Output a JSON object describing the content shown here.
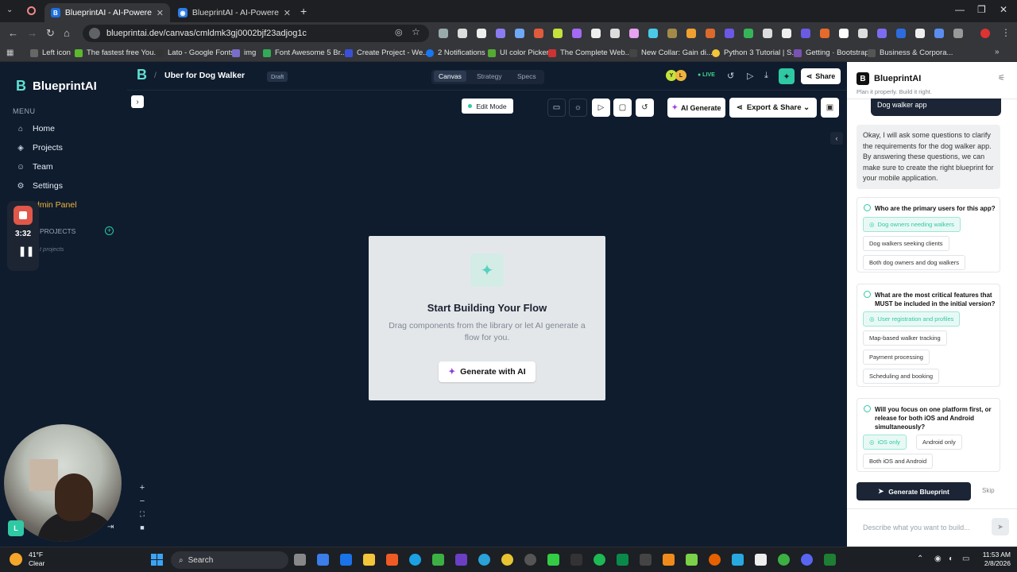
{
  "browser": {
    "tabs": [
      {
        "label": "BlueprintAI - AI-Powered P",
        "active": true
      },
      {
        "label": "BlueprintAI - AI-Powered Proje",
        "active": false
      }
    ],
    "url": "blueprintai.dev/canvas/cmldmk3gj0002bjf23adjog1c",
    "bookmarks": [
      "Left icon",
      "The fastest free You...",
      "Lato - Google Fonts",
      "img",
      "Font Awesome 5 Br...",
      "Create Project - We...",
      "2 Notifications",
      "UI color Picker",
      "The Complete Web...",
      "New Collar: Gain di...",
      "Python 3 Tutorial | S...",
      "Getting · Bootstrap",
      "Business & Corpora..."
    ]
  },
  "sidebar": {
    "brand": "BlueprintAI",
    "menu_label": "MENU",
    "items": [
      {
        "label": "Home",
        "icon": "home-icon"
      },
      {
        "label": "Projects",
        "icon": "layers-icon"
      },
      {
        "label": "Team",
        "icon": "team-icon"
      },
      {
        "label": "Settings",
        "icon": "gear-icon"
      },
      {
        "label": "dmin Panel",
        "icon": "shield-icon"
      }
    ],
    "projects_label": "PROJECTS",
    "projects_empty": "t projects",
    "recorder_time": "3:32",
    "user_initial": "L"
  },
  "canvas_header": {
    "logo": "B",
    "separator": "/",
    "project_title": "Uber for Dog Walker",
    "status_badge": "Draft",
    "view_tabs": [
      "Canvas",
      "Strategy",
      "Specs"
    ],
    "selected_view": "Canvas",
    "avatars": [
      "Y",
      "L"
    ],
    "live_label": "● LIVE",
    "share_label": "Share"
  },
  "toolbar": {
    "edit_mode": "Edit Mode",
    "ai_generate": "AI Generate",
    "export_share": "Export & Share ⌄"
  },
  "empty_state": {
    "title": "Start Building Your Flow",
    "description": "Drag components from the library or let AI generate a flow for you.",
    "button": "Generate with AI"
  },
  "ai_panel": {
    "title": "BlueprintAI",
    "subtitle": "Plan it properly. Build it right.",
    "user_message": "Dog walker app",
    "ai_message": "Okay, I will ask some questions to clarify the requirements for the dog walker app. By answering these questions, we can make sure to create the right blueprint for your mobile application.",
    "questions": [
      {
        "question": "Who are the primary users for this app?",
        "options": [
          "Dog owners needing walkers",
          "Dog walkers seeking clients",
          "Both dog owners and dog walkers"
        ],
        "selected": 0
      },
      {
        "question": "What are the most critical features that MUST be included in the initial version?",
        "options": [
          "User registration and profiles",
          "Map-based walker tracking",
          "Payment processing",
          "Scheduling and booking"
        ],
        "selected": 0
      },
      {
        "question": "Will you focus on one platform first, or release for both iOS and Android simultaneously?",
        "options": [
          "iOS only",
          "Android only",
          "Both iOS and Android"
        ],
        "selected": 0
      }
    ],
    "generate_button": "Generate Blueprint",
    "skip": "Skip",
    "input_placeholder": "Describe what you want to build..."
  },
  "taskbar": {
    "temp": "41°F",
    "condition": "Clear",
    "search": "Search",
    "time": "11:53 AM",
    "date": "2/8/2026"
  },
  "colors": {
    "accent": "#2fc9a3",
    "app_bg": "#0f1c2e",
    "panel_bg": "#ffffff"
  }
}
